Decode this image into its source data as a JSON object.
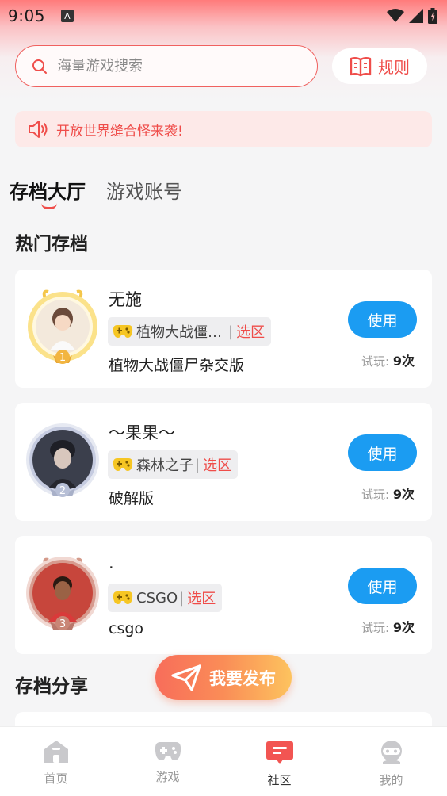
{
  "status_bar": {
    "time": "9:05",
    "notification_glyph": "A"
  },
  "search": {
    "placeholder": "海量游戏搜索",
    "value": ""
  },
  "rules_button": {
    "label": "规则"
  },
  "notice": {
    "text": "开放世界缝合怪来袭!"
  },
  "tabs": [
    {
      "label": "存档大厅",
      "active": true
    },
    {
      "label": "游戏账号",
      "active": false
    }
  ],
  "hot_section": {
    "title": "热门存档"
  },
  "cards": [
    {
      "rank": "1",
      "name": "无施",
      "game": "植物大战僵…",
      "separator": "|",
      "region": "选区",
      "desc": "植物大战僵尸杂交版",
      "button": "使用",
      "trial_label": "试玩:",
      "trial_count": "9次"
    },
    {
      "rank": "2",
      "name": "～果果～",
      "game": "森林之子",
      "separator": "|",
      "region": "选区",
      "desc": "破解版",
      "button": "使用",
      "trial_label": "试玩:",
      "trial_count": "9次"
    },
    {
      "rank": "3",
      "name": ".",
      "game": "CSGO",
      "separator": "|",
      "region": "选区",
      "desc": "csgo",
      "button": "使用",
      "trial_label": "试玩:",
      "trial_count": "9次"
    }
  ],
  "share_section": {
    "title": "存档分享"
  },
  "publish_button": {
    "label": "我要发布"
  },
  "bottom_nav": [
    {
      "label": "首页",
      "icon": "home-icon",
      "active": false
    },
    {
      "label": "游戏",
      "icon": "gamepad-icon",
      "active": false
    },
    {
      "label": "社区",
      "icon": "community-icon",
      "active": true
    },
    {
      "label": "我的",
      "icon": "profile-icon",
      "active": false
    }
  ],
  "colors": {
    "accent": "#ef4d4a",
    "button_blue": "#1b9cf2",
    "gold_badge": "#f4c64a",
    "silver_badge": "#b7bfd6",
    "bronze_badge": "#d49a8a"
  }
}
